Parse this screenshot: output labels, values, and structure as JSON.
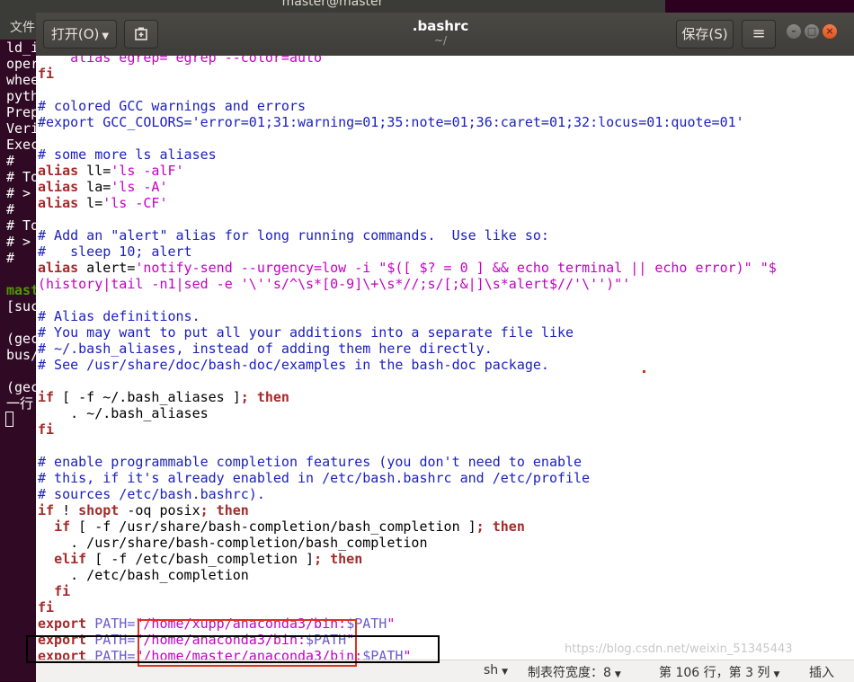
{
  "terminal": {
    "title": "master@master",
    "menu_label": "文件",
    "lines": [
      "ld_i",
      "oper",
      "whee",
      "pyth",
      "Prep",
      "Veri",
      "Exec",
      "#",
      "# To",
      "# >",
      "#",
      "# To",
      "# >",
      "#",
      "",
      "mast",
      "[suc",
      "",
      "(gec",
      "bus/",
      "",
      "(gec",
      "一行"
    ]
  },
  "header": {
    "open_label": "打开(O)",
    "save_label": "保存(S)",
    "title": ".bashrc",
    "subtitle": "~/"
  },
  "editor": {
    "lines": [
      [
        {
          "t": "    alias egrep='egrep --color=auto'",
          "c": "clip"
        }
      ],
      [
        {
          "t": "fi",
          "c": "kw"
        }
      ],
      [],
      [
        {
          "t": "# colored GCC warnings and errors",
          "c": "com"
        }
      ],
      [
        {
          "t": "#export GCC_COLORS='error=01;31:warning=01;35:note=01;36:caret=01;32:locus=01:quote=01'",
          "c": "com"
        }
      ],
      [],
      [
        {
          "t": "# some more ls aliases",
          "c": "com"
        }
      ],
      [
        {
          "t": "alias",
          "c": "kw"
        },
        {
          "t": " ll=",
          "c": "plain"
        },
        {
          "t": "'ls -alF'",
          "c": "str"
        }
      ],
      [
        {
          "t": "alias",
          "c": "kw"
        },
        {
          "t": " la=",
          "c": "plain"
        },
        {
          "t": "'ls -A'",
          "c": "str"
        }
      ],
      [
        {
          "t": "alias",
          "c": "kw"
        },
        {
          "t": " l=",
          "c": "plain"
        },
        {
          "t": "'ls -CF'",
          "c": "str"
        }
      ],
      [],
      [
        {
          "t": "# Add an \"alert\" alias for long running commands.  Use like so:",
          "c": "com"
        }
      ],
      [
        {
          "t": "#   sleep 10; alert",
          "c": "com"
        }
      ],
      [
        {
          "t": "alias",
          "c": "kw"
        },
        {
          "t": " alert=",
          "c": "plain"
        },
        {
          "t": "'notify-send --urgency=low -i \"$([ $? = 0 ] && echo terminal || echo error)\" \"$",
          "c": "str"
        }
      ],
      [
        {
          "t": "(history|tail -n1|sed -e '\\''s/^\\s*[0-9]\\+\\s*//;s/[;&|]\\s*alert$//'\\'')\"'",
          "c": "str"
        }
      ],
      [],
      [
        {
          "t": "# Alias definitions.",
          "c": "com"
        }
      ],
      [
        {
          "t": "# You may want to put all your additions into a separate file like",
          "c": "com"
        }
      ],
      [
        {
          "t": "# ~/.bash_aliases, instead of adding them here directly.",
          "c": "com"
        }
      ],
      [
        {
          "t": "# See /usr/share/doc/bash-doc/examples in the bash-doc package.",
          "c": "com"
        }
      ],
      [],
      [
        {
          "t": "if",
          "c": "kw"
        },
        {
          "t": " [ -f ~/.bash_aliases ]",
          "c": "plain"
        },
        {
          "t": "; then",
          "c": "kw"
        }
      ],
      [
        {
          "t": "    . ~/.bash_aliases",
          "c": "plain"
        }
      ],
      [
        {
          "t": "fi",
          "c": "kw"
        }
      ],
      [],
      [
        {
          "t": "# enable programmable completion features (you don't need to enable",
          "c": "com"
        }
      ],
      [
        {
          "t": "# this, if it's already enabled in /etc/bash.bashrc and /etc/profile",
          "c": "com"
        }
      ],
      [
        {
          "t": "# sources /etc/bash.bashrc).",
          "c": "com"
        }
      ],
      [
        {
          "t": "if",
          "c": "kw"
        },
        {
          "t": " ! ",
          "c": "plain"
        },
        {
          "t": "shopt",
          "c": "kw"
        },
        {
          "t": " -oq posix",
          "c": "plain"
        },
        {
          "t": "; then",
          "c": "kw"
        }
      ],
      [
        {
          "t": "  ",
          "c": "plain"
        },
        {
          "t": "if",
          "c": "kw"
        },
        {
          "t": " [ -f /usr/share/bash-completion/bash_completion ]",
          "c": "plain"
        },
        {
          "t": "; then",
          "c": "kw"
        }
      ],
      [
        {
          "t": "    . /usr/share/bash-completion/bash_completion",
          "c": "plain"
        }
      ],
      [
        {
          "t": "  ",
          "c": "plain"
        },
        {
          "t": "elif",
          "c": "kw"
        },
        {
          "t": " [ -f /etc/bash_completion ]",
          "c": "plain"
        },
        {
          "t": "; then",
          "c": "kw"
        }
      ],
      [
        {
          "t": "    . /etc/bash_completion",
          "c": "plain"
        }
      ],
      [
        {
          "t": "  ",
          "c": "plain"
        },
        {
          "t": "fi",
          "c": "kw"
        }
      ],
      [
        {
          "t": "fi",
          "c": "kw"
        }
      ],
      [
        {
          "t": "export",
          "c": "kw"
        },
        {
          "t": " PATH=",
          "c": "var"
        },
        {
          "t": "\"/home/xupp/anaconda3/bin:",
          "c": "str"
        },
        {
          "t": "$PATH",
          "c": "var"
        },
        {
          "t": "\"",
          "c": "str"
        }
      ],
      [
        {
          "t": "export",
          "c": "kw"
        },
        {
          "t": " PATH=",
          "c": "var"
        },
        {
          "t": "\"/home/anaconda3/bin:",
          "c": "str"
        },
        {
          "t": "$PATH",
          "c": "var"
        },
        {
          "t": "\"",
          "c": "str"
        }
      ],
      [
        {
          "t": "export",
          "c": "kw"
        },
        {
          "t": " PATH=",
          "c": "var"
        },
        {
          "t": "\"/home/master/anaconda3/bin:",
          "c": "str"
        },
        {
          "t": "$PATH",
          "c": "var"
        },
        {
          "t": "\"",
          "c": "str"
        }
      ]
    ]
  },
  "statusbar": {
    "language": "sh",
    "tab_width": "制表符宽度：8",
    "position": "第 106 行，第 3 列",
    "insert_mode": "插入"
  },
  "watermark": "https://blog.csdn.net/weixin_51345443",
  "colors": {
    "comment": "#1c20bf",
    "keyword": "#a52a2a",
    "string": "#c400c4",
    "variable": "#6a5acd",
    "annotation_red": "#e0301e",
    "annotation_black": "#000000"
  }
}
